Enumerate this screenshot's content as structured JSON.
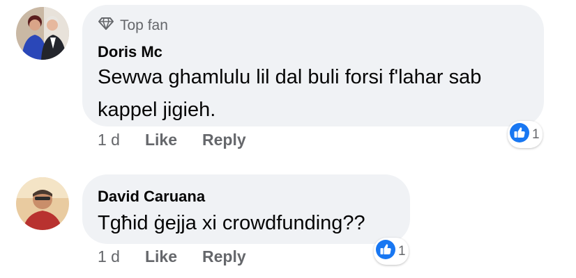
{
  "comments": [
    {
      "badge": "Top fan",
      "badge_icon": "diamond-icon",
      "author": "Doris Mc",
      "text_lines": [
        "Sewwa ghamlulu lil dal buli forsi f'lahar sab",
        "kappel jigieh."
      ],
      "time": "1 d",
      "like": "Like",
      "reply": "Reply",
      "reaction_icon": "thumbs-up-icon",
      "reaction_count": "1"
    },
    {
      "author": "David Caruana",
      "text_lines": [
        "Tgħid ġejja xi crowdfunding??"
      ],
      "time": "1 d",
      "like": "Like",
      "reply": "Reply",
      "reaction_icon": "thumbs-up-icon",
      "reaction_count": "1"
    }
  ],
  "colors": {
    "bubble": "#f0f2f5",
    "secondary_text": "#65676b",
    "like_blue": "#1877f2"
  }
}
